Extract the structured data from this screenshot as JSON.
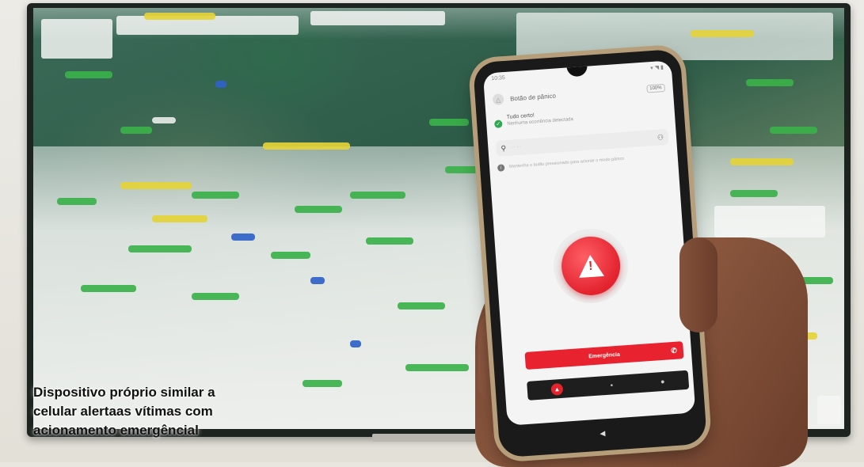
{
  "caption": {
    "line1": "Dispositivo próprio similar a",
    "line2": "celular alertaas vítimas com",
    "line3": "acionamento emergêncial"
  },
  "phone": {
    "time": "10:35",
    "app_title": "Botão de pânico",
    "battery": "100%",
    "status_title": "Tudo certo!",
    "status_sub": "Nenhuma ocorrência detectada",
    "info_text": "Mantenha o botão pressionado para acionar o modo pânico",
    "emergency_label": "Emergência",
    "icons": {
      "app": "shield-icon",
      "check": "check-icon",
      "location": "location-pin-icon",
      "add_user": "add-user-icon",
      "info": "info-icon",
      "panic": "warning-icon",
      "phone": "phone-icon",
      "chat": "chat-icon",
      "profile": "profile-icon",
      "back": "back-icon"
    },
    "colors": {
      "panic_red": "#e3232e",
      "ok_green": "#2fa84f"
    }
  }
}
